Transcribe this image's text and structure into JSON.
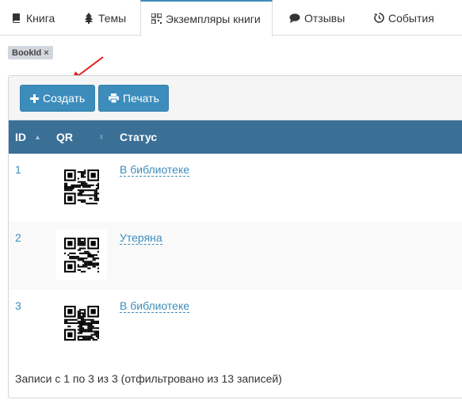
{
  "tabs": [
    {
      "label": "Книга",
      "icon": "book-icon"
    },
    {
      "label": "Темы",
      "icon": "tree-icon"
    },
    {
      "label": "Экземпляры книги",
      "icon": "qrcode-icon"
    },
    {
      "label": "Отзывы",
      "icon": "comment-icon"
    },
    {
      "label": "События",
      "icon": "history-icon"
    }
  ],
  "filter": {
    "label": "BookId",
    "close": "×"
  },
  "toolbar": {
    "create_label": "Создать",
    "print_label": "Печать"
  },
  "table": {
    "headers": {
      "id": "ID",
      "qr": "QR",
      "status": "Статус"
    },
    "rows": [
      {
        "id": "1",
        "status": "В библиотеке"
      },
      {
        "id": "2",
        "status": "Утеряна"
      },
      {
        "id": "3",
        "status": "В библиотеке"
      }
    ]
  },
  "footer": {
    "info": "Записи с 1 по 3 из 3 (отфильтровано из 13 записей)"
  },
  "colors": {
    "primary": "#3c8dbc",
    "header": "#3a6f96",
    "annotation_arrow": "#e02020"
  }
}
